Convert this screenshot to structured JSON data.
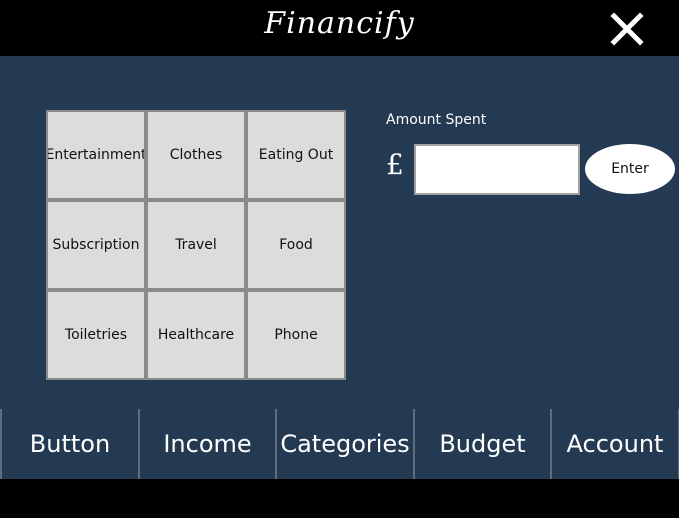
{
  "app": {
    "title": "Financify",
    "close_icon": "close-icon"
  },
  "categories": [
    {
      "label": "Entertainment"
    },
    {
      "label": "Clothes"
    },
    {
      "label": "Eating Out"
    },
    {
      "label": "Subscription"
    },
    {
      "label": "Travel"
    },
    {
      "label": "Food"
    },
    {
      "label": "Toiletries"
    },
    {
      "label": "Healthcare"
    },
    {
      "label": "Phone"
    }
  ],
  "amount": {
    "label": "Amount Spent",
    "currency_symbol": "£",
    "value": "",
    "enter_label": "Enter"
  },
  "nav": [
    {
      "label": "Button"
    },
    {
      "label": "Income"
    },
    {
      "label": "Categories"
    },
    {
      "label": "Budget"
    },
    {
      "label": "Account"
    }
  ],
  "colors": {
    "panel": "#243a52",
    "bar": "#000000",
    "button_face": "#dcdcdc"
  }
}
